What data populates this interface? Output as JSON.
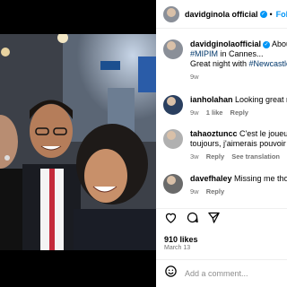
{
  "post": {
    "username": "davidginola official",
    "follow_label": "Follo",
    "dot": "•",
    "caption_user": "davidginolaofficial",
    "caption_text": " About l",
    "caption_tag1": "#MIPIM",
    "caption_line2": " in Cannes...",
    "caption_line3": "Great night with ",
    "caption_tag2": "#Newcastle",
    "caption_time": "9w",
    "likes": "910 likes",
    "date": "March 13",
    "add_comment_placeholder": "Add a comment..."
  },
  "comments": [
    {
      "user": "ianholahan",
      "text": " Looking great ma",
      "time": "9w",
      "likes": "1 like",
      "reply": "Reply"
    },
    {
      "user": "tahaoztuncc",
      "text": " C'est le joueur de",
      "text2": "toujours, j'aimerais pouvoir le",
      "time": "3w",
      "reply": "Reply",
      "translate": "See translation"
    },
    {
      "user": "davefhaley",
      "text": " Missing me thoug",
      "time": "9w",
      "reply": "Reply"
    }
  ],
  "colors": {
    "accent": "#0095f6",
    "hashtag": "#00376b",
    "muted": "#737373"
  },
  "icons": [
    "verified-badge-icon",
    "heart-icon",
    "comment-icon",
    "share-icon",
    "emoji-icon"
  ]
}
